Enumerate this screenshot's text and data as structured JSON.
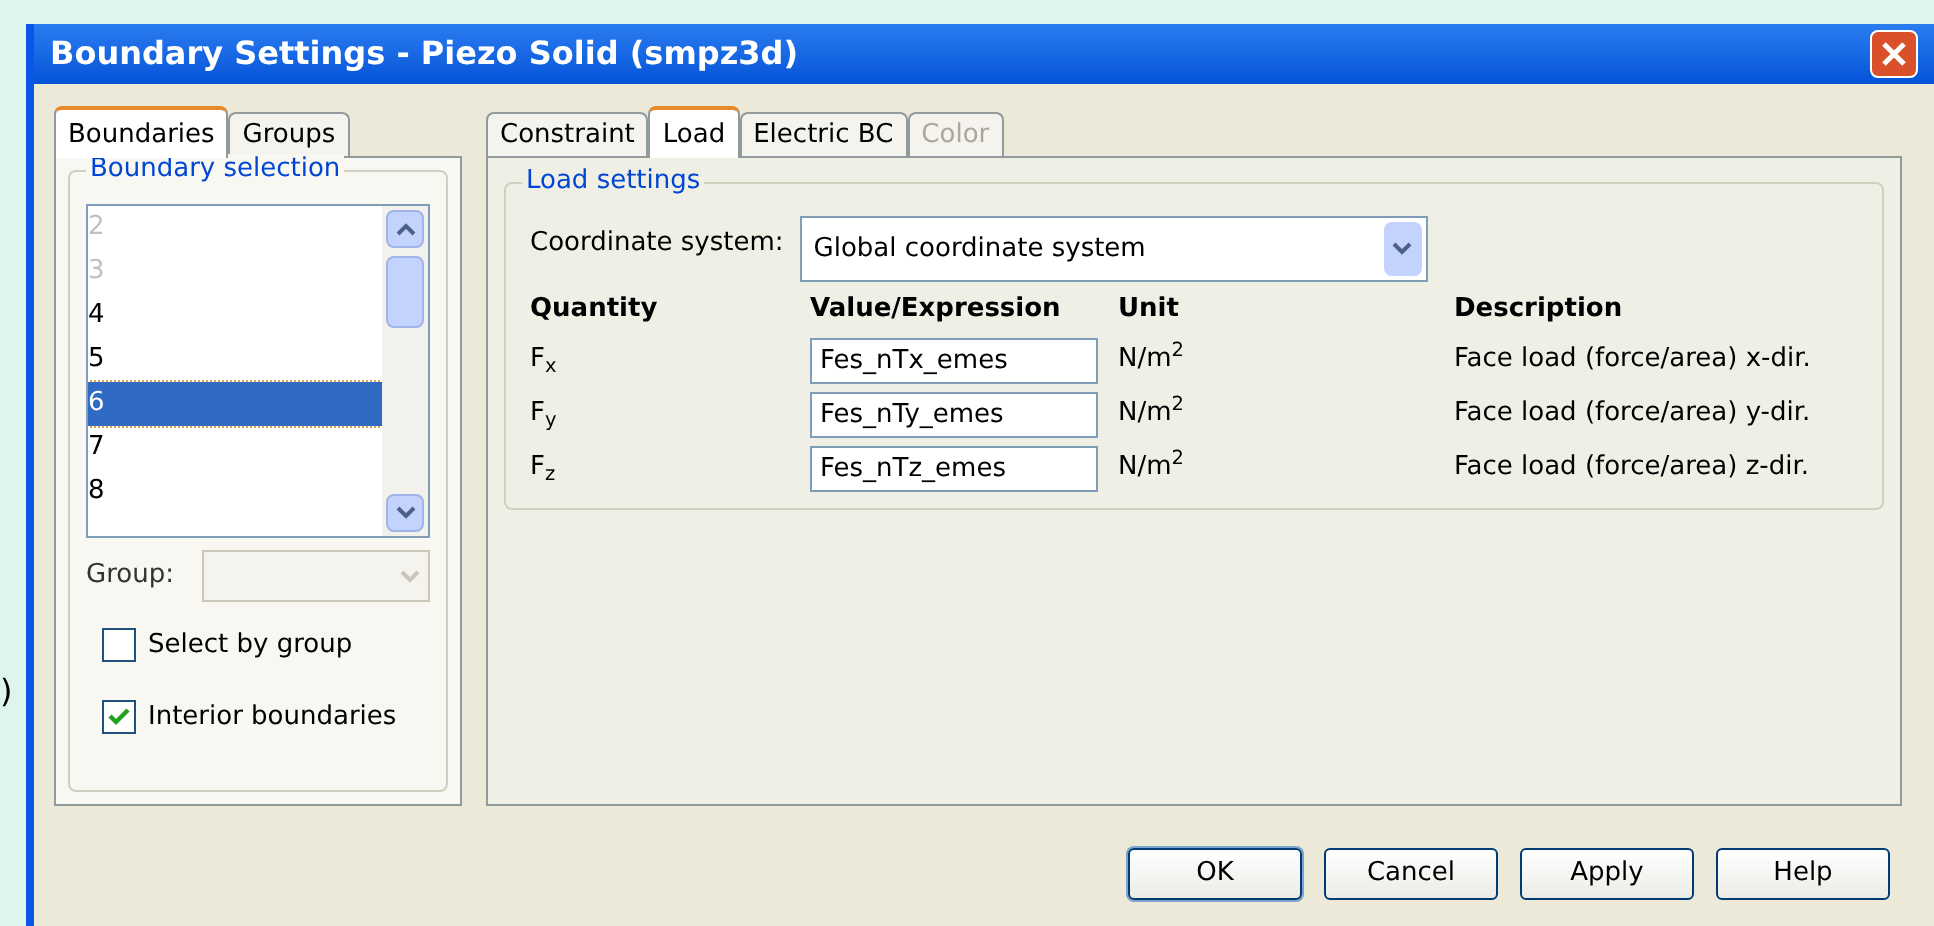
{
  "background_text": ")",
  "window": {
    "title": "Boundary Settings - Piezo Solid (smpz3d)"
  },
  "left_tabs": [
    {
      "label": "Boundaries",
      "selected": true
    },
    {
      "label": "Groups",
      "selected": false
    }
  ],
  "boundary_selection": {
    "title": "Boundary selection",
    "items": [
      {
        "label": "2",
        "disabled": true,
        "selected": false
      },
      {
        "label": "3",
        "disabled": true,
        "selected": false
      },
      {
        "label": "4",
        "disabled": false,
        "selected": false
      },
      {
        "label": "5",
        "disabled": false,
        "selected": false
      },
      {
        "label": "6",
        "disabled": false,
        "selected": true
      },
      {
        "label": "7",
        "disabled": false,
        "selected": false
      },
      {
        "label": "8",
        "disabled": false,
        "selected": false
      }
    ],
    "group_label": "Group:",
    "checkboxes": [
      {
        "label": "Select by group",
        "checked": false
      },
      {
        "label": "Interior boundaries",
        "checked": true
      }
    ]
  },
  "right_tabs": [
    {
      "label": "Constraint",
      "selected": false,
      "disabled": false
    },
    {
      "label": "Load",
      "selected": true,
      "disabled": false
    },
    {
      "label": "Electric BC",
      "selected": false,
      "disabled": false
    },
    {
      "label": "Color",
      "selected": false,
      "disabled": true
    }
  ],
  "load_settings": {
    "title": "Load settings",
    "coordinate_label": "Coordinate system:",
    "coordinate_value": "Global coordinate system",
    "columns": [
      "Quantity",
      "Value/Expression",
      "Unit",
      "Description"
    ],
    "rows": [
      {
        "quantity": "F$_{x}$",
        "value": "Fes_nTx_emes",
        "unit": "N/m$^{2}$",
        "description": "Face load (force/area) x-dir."
      },
      {
        "quantity": "F$_{y}$",
        "value": "Fes_nTy_emes",
        "unit": "N/m$^{2}$",
        "description": "Face load (force/area) y-dir."
      },
      {
        "quantity": "F$_{z}$",
        "value": "Fes_nTz_emes",
        "unit": "N/m$^{2}$",
        "description": "Face load (force/area) z-dir."
      }
    ]
  },
  "buttons": [
    {
      "label": "OK",
      "default": true
    },
    {
      "label": "Cancel",
      "default": false
    },
    {
      "label": "Apply",
      "default": false
    },
    {
      "label": "Help",
      "default": false
    }
  ]
}
